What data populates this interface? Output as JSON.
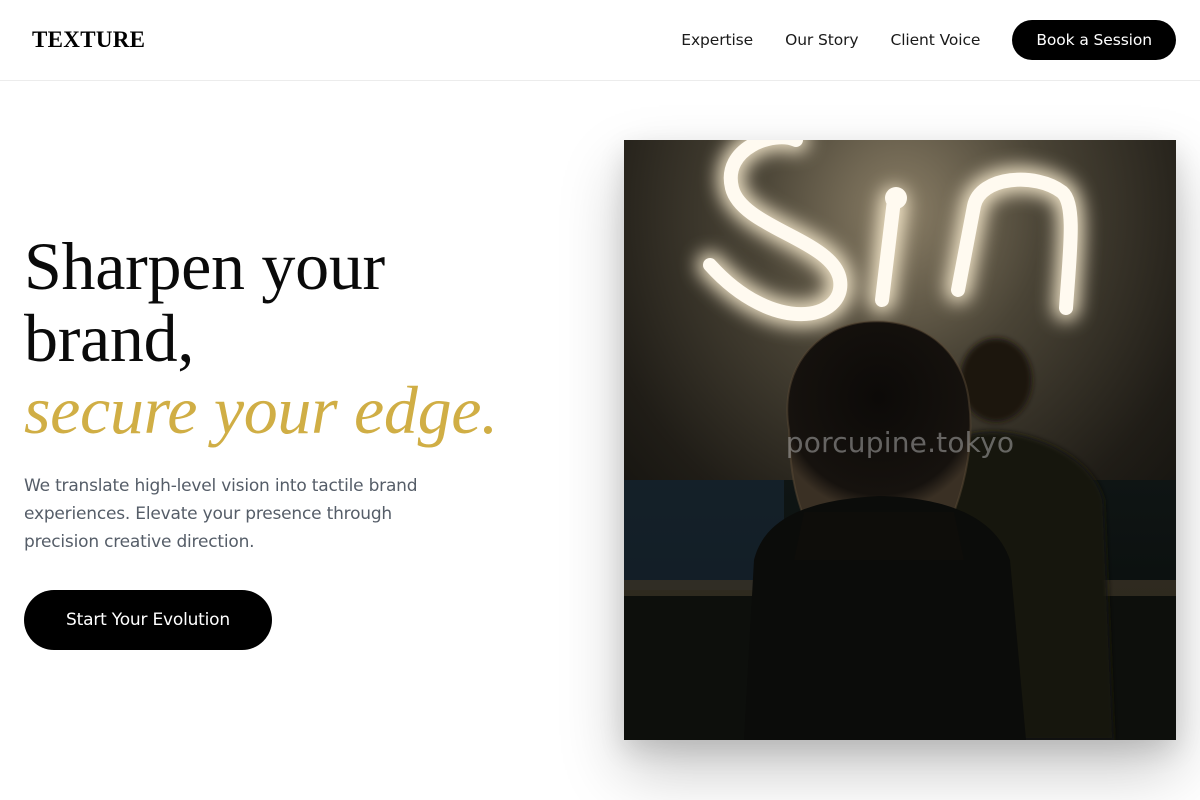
{
  "header": {
    "logo": "TEXTURE",
    "nav": [
      "Expertise",
      "Our Story",
      "Client Voice"
    ],
    "cta": "Book a Session"
  },
  "hero": {
    "headline_line1": "Sharpen your",
    "headline_line2": "brand,",
    "headline_accent": "secure your edge.",
    "subtext": "We translate high-level vision into tactile brand experiences. Elevate your presence through precision creative direction.",
    "cta": "Start Your Evolution"
  },
  "image": {
    "watermark": "porcupine.tokyo",
    "neon_text": "Sin"
  },
  "colors": {
    "accent": "#d0ae45",
    "button_bg": "#000000",
    "body_text": "#555d68"
  }
}
